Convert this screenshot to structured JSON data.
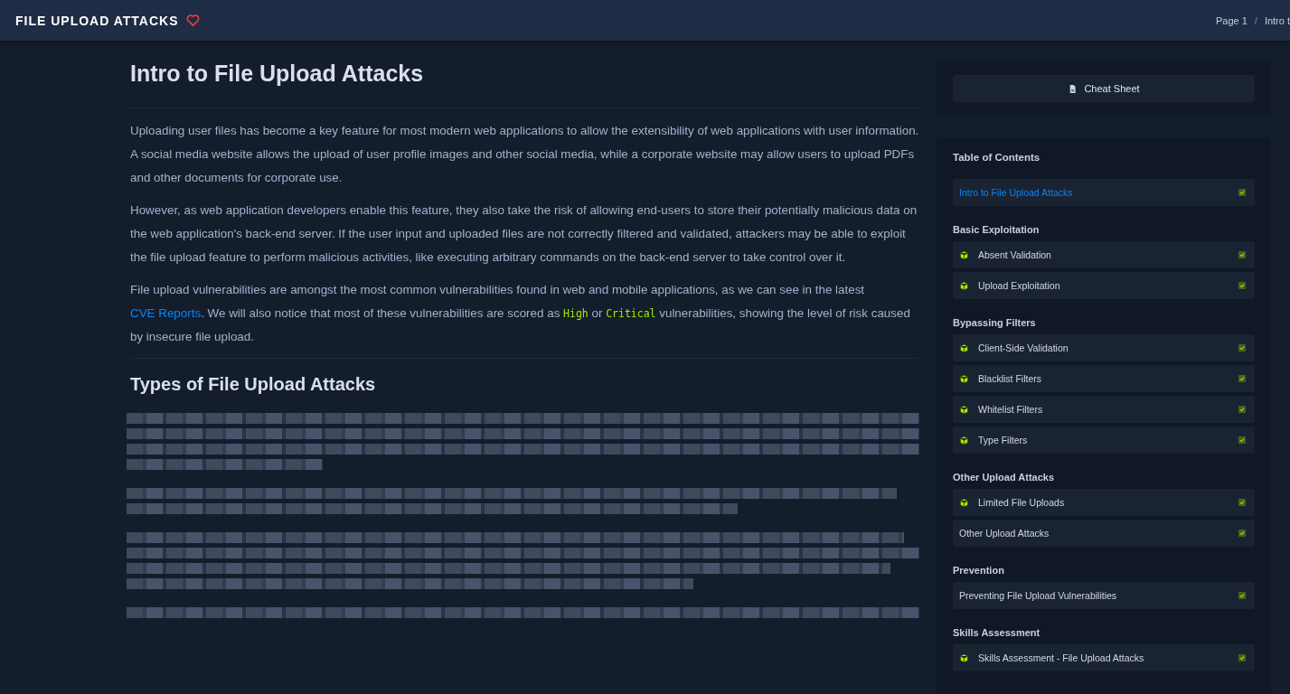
{
  "header": {
    "title": "FILE UPLOAD ATTACKS",
    "favorite": true,
    "breadcrumb": [
      {
        "label": "Page 1"
      },
      {
        "label": "Intro t"
      }
    ],
    "separator": "/"
  },
  "article": {
    "title": "Intro to File Upload Attacks",
    "paragraphs": [
      [
        {
          "kind": "text",
          "text": "Uploading user files has become a key feature for most modern web applications to allow the extensibility of web applications with user information. A social media website allows the upload of user profile images and other social media, while a corporate website may allow users to upload PDFs and other documents for corporate use."
        }
      ],
      [
        {
          "kind": "text",
          "text": "However, as web application developers enable this feature, they also take the risk of allowing end-users to store their potentially malicious data on the web application's back-end server. If the user input and uploaded files are not correctly filtered and validated, attackers may be able to exploit the file upload feature to perform malicious activities, like executing arbitrary commands on the back-end server to take control over it."
        }
      ],
      [
        {
          "kind": "text",
          "text": "File upload vulnerabilities are amongst the most common vulnerabilities found in web and mobile applications, as we can see in the latest "
        },
        {
          "kind": "link",
          "text": "CVE Reports"
        },
        {
          "kind": "text",
          "text": ". We will also notice that most of these vulnerabilities are scored as "
        },
        {
          "kind": "code",
          "text": "High"
        },
        {
          "kind": "text",
          "text": " or "
        },
        {
          "kind": "code",
          "text": "Critical"
        },
        {
          "kind": "text",
          "text": " vulnerabilities, showing the level of risk caused by insecure file upload."
        }
      ]
    ],
    "subheading": "Types of File Upload Attacks"
  },
  "sidebar": {
    "cheat_sheet": "Cheat Sheet",
    "toc_title": "Table of Contents",
    "sections": [
      {
        "items": [
          {
            "label": "Intro to File Upload Attacks",
            "has_icon": false,
            "selected": true,
            "completed": true
          }
        ]
      },
      {
        "title": "Basic Exploitation",
        "items": [
          {
            "label": "Absent Validation",
            "has_icon": true,
            "selected": false,
            "completed": true
          },
          {
            "label": "Upload Exploitation",
            "has_icon": true,
            "selected": false,
            "completed": true
          }
        ]
      },
      {
        "title": "Bypassing Filters",
        "items": [
          {
            "label": "Client-Side Validation",
            "has_icon": true,
            "selected": false,
            "completed": true
          },
          {
            "label": "Blacklist Filters",
            "has_icon": true,
            "selected": false,
            "completed": true
          },
          {
            "label": "Whitelist Filters",
            "has_icon": true,
            "selected": false,
            "completed": true
          },
          {
            "label": "Type Filters",
            "has_icon": true,
            "selected": false,
            "completed": true
          }
        ]
      },
      {
        "title": "Other Upload Attacks",
        "items": [
          {
            "label": "Limited File Uploads",
            "has_icon": true,
            "selected": false,
            "completed": true
          },
          {
            "label": "Other Upload Attacks",
            "has_icon": false,
            "selected": false,
            "completed": true
          }
        ]
      },
      {
        "title": "Prevention",
        "items": [
          {
            "label": "Preventing File Upload Vulnerabilities",
            "has_icon": false,
            "selected": false,
            "completed": true
          }
        ]
      },
      {
        "title": "Skills Assessment",
        "items": [
          {
            "label": "Skills Assessment - File Upload Attacks",
            "has_icon": true,
            "selected": false,
            "completed": true
          }
        ]
      }
    ]
  }
}
